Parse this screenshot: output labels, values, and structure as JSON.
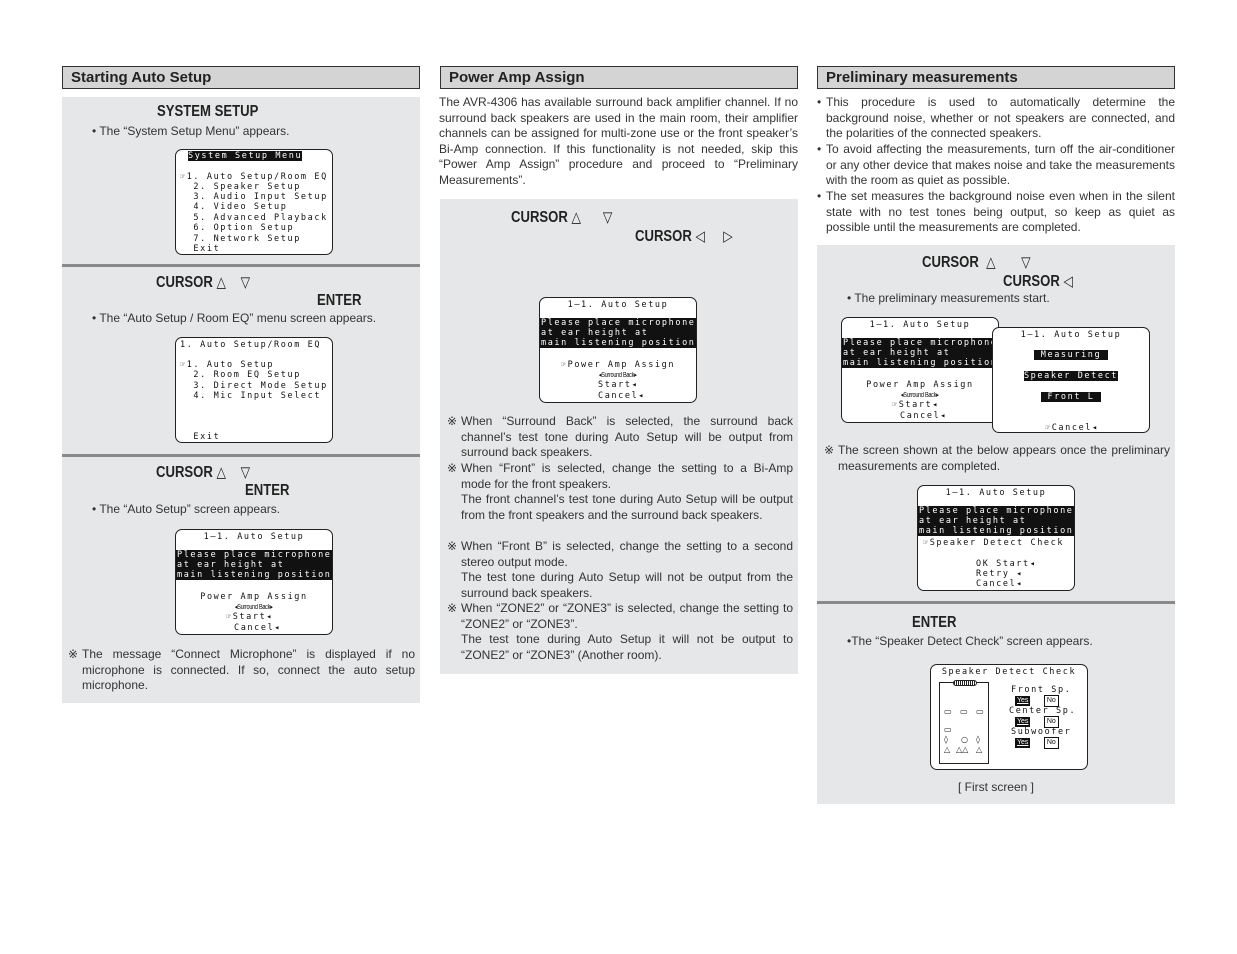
{
  "sections": {
    "auto_setup": {
      "title": "Starting Auto Setup",
      "step1": {
        "key": "SYSTEM SETUP",
        "desc": "• The “System Setup Menu” appears.",
        "screen": {
          "title": "System Setup Menu",
          "items": [
            "☞1. Auto Setup/Room EQ",
            "  2. Speaker Setup",
            "  3. Audio Input Setup",
            "  4. Video Setup",
            "  5. Advanced Playback",
            "  6. Option Setup",
            "  7. Network Setup",
            "  Exit"
          ]
        }
      },
      "step2": {
        "key_cursor": "CURSOR",
        "up": "△",
        "down": "▽",
        "key_enter": "ENTER",
        "desc": "• The “Auto Setup / Room EQ” menu screen appears.",
        "screen": {
          "title": "1. Auto Setup/Room EQ",
          "items": [
            "☞1. Auto Setup",
            "  2. Room EQ Setup",
            "  3. Direct Mode Setup",
            "  4. Mic Input Select"
          ],
          "exit": "  Exit"
        }
      },
      "step3": {
        "key_cursor": "CURSOR",
        "up": "△",
        "down": "▽",
        "key_enter": "ENTER",
        "desc": "• The “Auto Setup” screen appears.",
        "screen": {
          "title": "1—1. Auto Setup",
          "message": [
            "Please place microphone",
            "at ear height at",
            "main listening position."
          ],
          "assign_label": "Power Amp Assign",
          "assign_value": "◂Surround Back▸",
          "start": "☞Start◂",
          "cancel": "Cancel◂"
        },
        "note": "The message “Connect Microphone” is displayed if no microphone is connected. If so, connect the auto setup microphone."
      }
    },
    "power_amp": {
      "title": "Power Amp Assign",
      "intro": "The AVR-4306 has available surround back amplifier channel. If no surround back speakers are used in the main room, their amplifier channels can be assigned for multi-zone use or the front speaker’s Bi-Amp connection. If this functionality is not needed, skip this “Power Amp Assign” procedure and proceed to “Preliminary Measurements”.",
      "step": {
        "key_cursor": "CURSOR",
        "up": "△",
        "down": "▽",
        "left": "◁",
        "right": "▷",
        "screen": {
          "title": "1—1. Auto Setup",
          "message": [
            "Please place microphone",
            "at ear height at",
            "main listening position."
          ],
          "assign_label": "☞Power Amp Assign",
          "assign_value": "◂Surround Back▸",
          "start": "Start◂",
          "cancel": "Cancel◂"
        }
      },
      "notes": [
        "When “Surround Back” is selected, the surround back channel’s test tone during Auto Setup will be output from surround back speakers.",
        "When “Front” is selected, change the setting to a Bi-Amp mode for the front speakers.\nThe front channel’s test tone during Auto Setup will be output from the front speakers and the surround back speakers.",
        "When “Front B” is selected, change the setting to a second stereo output mode.\nThe test tone during Auto Setup will not be output from the surround back speakers.",
        "When “ZONE2” or “ZONE3” is selected, change the setting to “ZONE2” or “ZONE3”.\nThe test tone during Auto Setup it will not be output to “ZONE2” or “ZONE3” (Another room)."
      ],
      "note_mark": "※"
    },
    "preliminary": {
      "title": "Preliminary measurements",
      "bullets": [
        "This procedure is used to automatically determine the background noise, whether or not speakers are connected, and the polarities of the connected speakers.",
        "To avoid affecting the measurements, turn off the air-conditioner or any other device that makes noise and take the measurements with the room as quiet as possible.",
        "The set measures the background noise even when in the silent state with no test tones being output, so keep as quiet as possible until the measurements are completed."
      ],
      "step1": {
        "key_cursor": "CURSOR",
        "up": "△",
        "down": "▽",
        "left": "◁",
        "desc": "• The preliminary measurements start.",
        "screen_a": {
          "title": "1—1. Auto Setup",
          "message": [
            "Please place microphone",
            "at ear height at",
            "main listening position"
          ],
          "assign_label": "Power Amp Assign",
          "assign_value": "◂Surround Back▸",
          "start": "☞Start◂",
          "cancel": "Cancel◂"
        },
        "screen_b": {
          "title": "1—1. Auto Setup",
          "measuring": " Measuring ",
          "detect": "Speaker Detect",
          "channel": " Front L ",
          "cancel": "☞Cancel◂"
        },
        "note": "The screen shown at the below appears once the preliminary measurements are completed.",
        "screen_c": {
          "title": "1—1. Auto Setup",
          "message": [
            "Please place microphone",
            "at ear height at",
            "main listening position."
          ],
          "check": "☞Speaker Detect Check",
          "ok": "OK Start◂",
          "retry": "Retry ◂",
          "cancel": "Cancel◂"
        }
      },
      "step2": {
        "key_enter": "ENTER",
        "desc": "•The “Speaker Detect Check” screen appears.",
        "screen": {
          "title": "Speaker Detect Check",
          "rows": [
            {
              "label": "Front Sp.",
              "yes": "Yes",
              "no": "No"
            },
            {
              "label": "Center Sp.",
              "yes": "Yes",
              "no": "No"
            },
            {
              "label": "Subwoofer",
              "yes": "Yes",
              "no": "No"
            }
          ]
        },
        "caption": "[ First screen ]"
      }
    }
  }
}
